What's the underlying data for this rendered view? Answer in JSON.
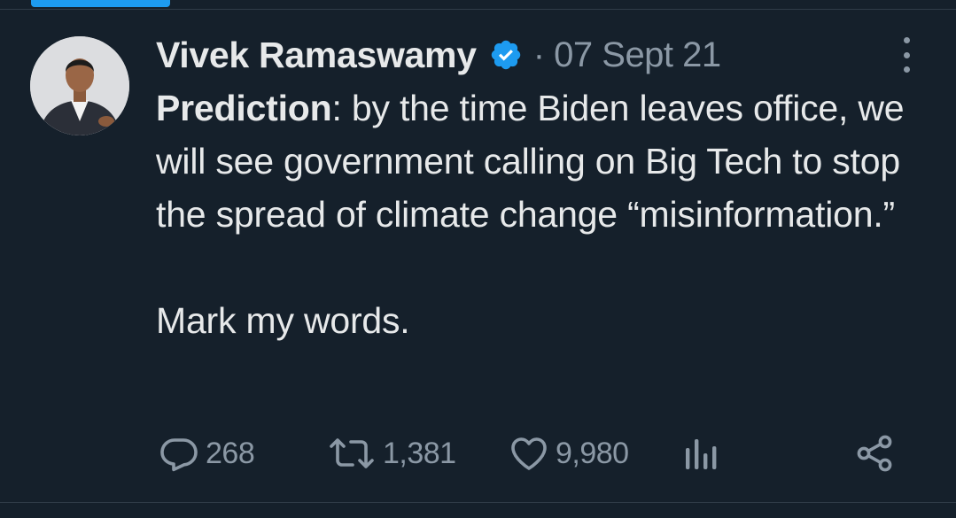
{
  "tweet": {
    "author": {
      "display_name": "Vivek Ramaswamy",
      "verified": true
    },
    "date": "· 07 Sept 21",
    "text_lead": "Prediction",
    "text_rest": ": by the time Biden leaves office, we will see government calling on Big Tech to stop the spread of climate change “misinformation.”",
    "text_second": "Mark my words."
  },
  "actions": {
    "replies": "268",
    "retweets": "1,381",
    "likes": "9,980"
  },
  "icons": {
    "reply": "reply-icon",
    "retweet": "retweet-icon",
    "like": "heart-icon",
    "views": "views-icon",
    "share": "share-icon",
    "more": "more-options-icon",
    "verified": "verified-badge-icon"
  },
  "colors": {
    "background": "#15202b",
    "text": "#e7e9ea",
    "muted": "#8b98a5",
    "accent": "#1d9bf0"
  }
}
